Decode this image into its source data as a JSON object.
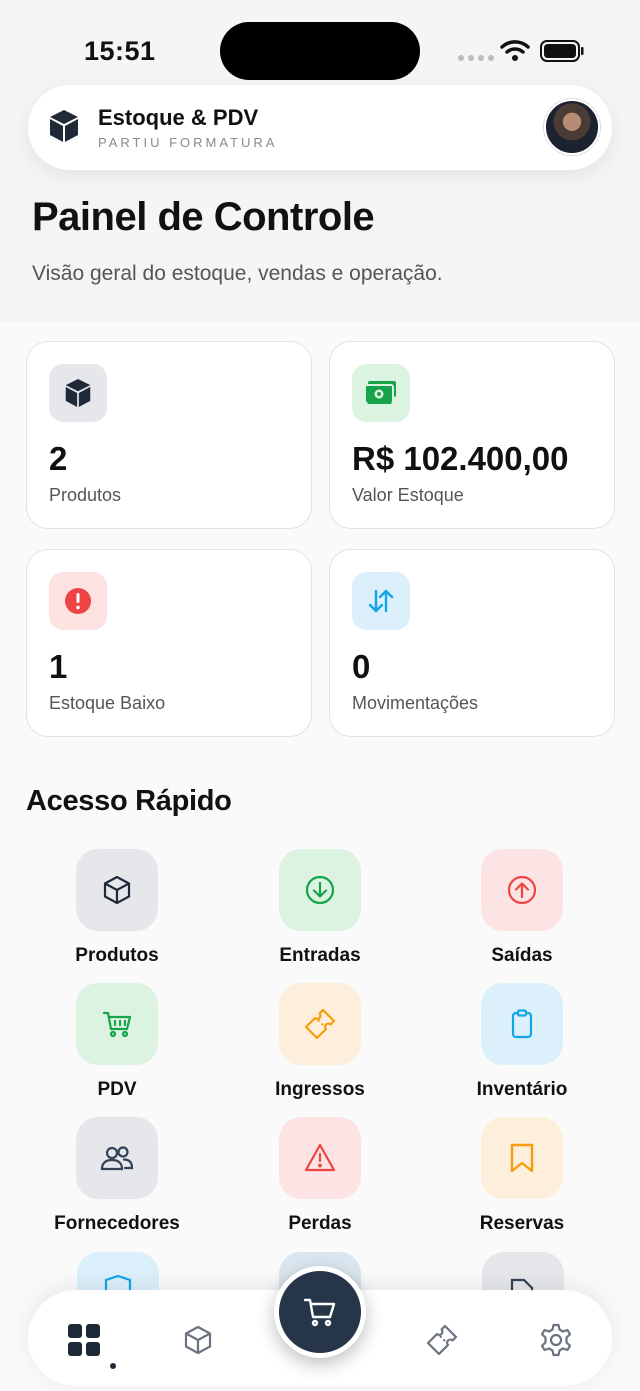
{
  "status": {
    "time": "15:51"
  },
  "header": {
    "title": "Estoque & PDV",
    "subtitle": "PARTIU FORMATURA"
  },
  "page": {
    "title": "Painel de Controle",
    "description": "Visão geral do estoque, vendas e operação."
  },
  "stats": [
    {
      "value": "2",
      "label": "Produtos",
      "icon": "cube-icon",
      "color": "#334155"
    },
    {
      "value": "R$ 102.400,00",
      "label": "Valor Estoque",
      "icon": "money-icon",
      "color": "#16a34a"
    },
    {
      "value": "1",
      "label": "Estoque Baixo",
      "icon": "alert-icon",
      "color": "#ef4444"
    },
    {
      "value": "0",
      "label": "Movimentações",
      "icon": "arrows-updown-icon",
      "color": "#0ea5e9"
    }
  ],
  "quick_access": {
    "title": "Acesso Rápido",
    "items": [
      {
        "label": "Produtos",
        "icon": "cube-icon"
      },
      {
        "label": "Entradas",
        "icon": "arrow-down-circle-icon"
      },
      {
        "label": "Saídas",
        "icon": "arrow-up-circle-icon"
      },
      {
        "label": "PDV",
        "icon": "cart-icon"
      },
      {
        "label": "Ingressos",
        "icon": "ticket-icon"
      },
      {
        "label": "Inventário",
        "icon": "clipboard-icon"
      },
      {
        "label": "Fornecedores",
        "icon": "users-icon"
      },
      {
        "label": "Perdas",
        "icon": "warning-icon"
      },
      {
        "label": "Reservas",
        "icon": "bookmark-icon"
      }
    ]
  },
  "bottom_nav": {
    "items": [
      "dashboard-icon",
      "cube-icon",
      "cart-icon",
      "ticket-icon",
      "gear-icon"
    ],
    "active": "dashboard-icon"
  }
}
